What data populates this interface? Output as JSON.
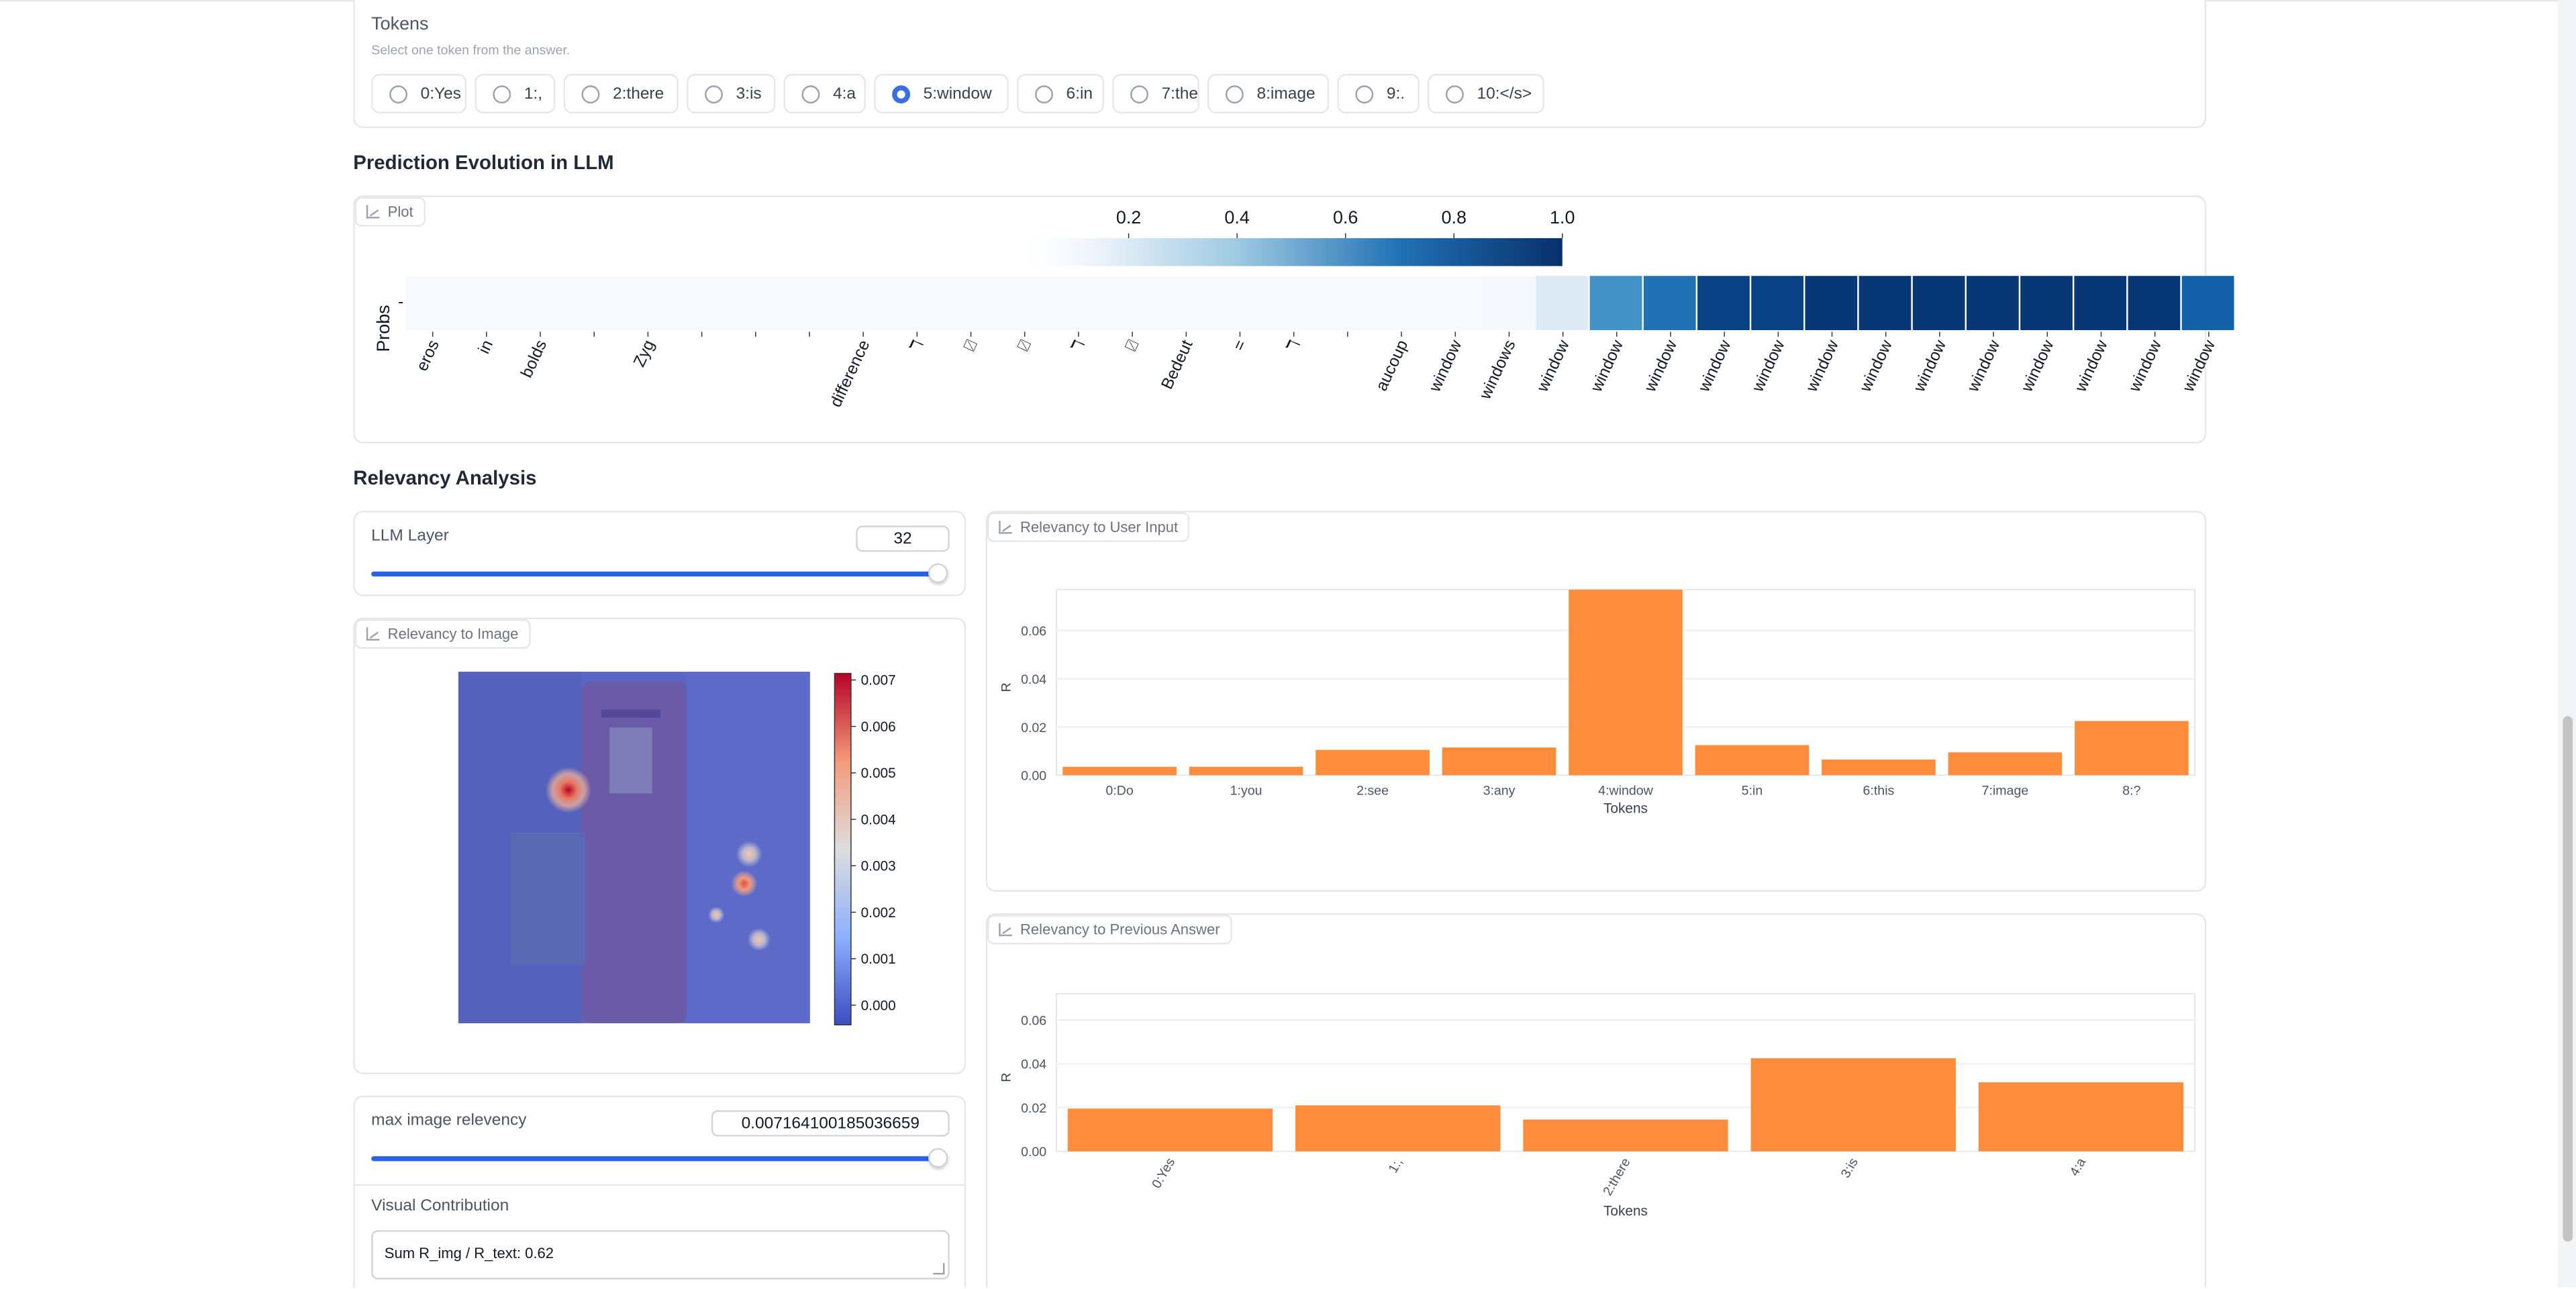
{
  "tokens_panel": {
    "title": "Tokens",
    "subtitle": "Select one token from the answer.",
    "options": [
      "0:Yes",
      "1:,",
      "2:there",
      "3:is",
      "4:a",
      "5:window",
      "6:in",
      "7:the",
      "8:image",
      "9:.",
      "10:</s>"
    ],
    "selected_index": 5
  },
  "prediction": {
    "section_title": "Prediction Evolution in LLM",
    "plot_tag": "Plot",
    "row_label": "Probs",
    "row_tick": "-",
    "colorbar_ticks": [
      "0.2",
      "0.4",
      "0.6",
      "0.8",
      "1.0"
    ],
    "colors": {
      "low": "#f7fbff",
      "high": "#08306b"
    }
  },
  "relevancy": {
    "section_title": "Relevancy Analysis",
    "llm_layer": {
      "label": "LLM Layer",
      "value": "32",
      "fraction": 1.0
    },
    "image_tag": "Relevancy to Image",
    "image_colorbar_ticks": [
      "0.007",
      "0.006",
      "0.005",
      "0.004",
      "0.003",
      "0.002",
      "0.001",
      "0.000"
    ],
    "user_input_tag": "Relevancy to User Input",
    "prev_answer_tag": "Relevancy to Previous Answer",
    "max_relevancy": {
      "label": "max image relevency",
      "value": "0.007164100185036659",
      "fraction": 1.0
    },
    "visual_contribution": {
      "label": "Visual Contribution",
      "value": "Sum R_img / R_text: 0.62"
    }
  },
  "chart_data": [
    {
      "type": "heatmap",
      "title": "",
      "ylabel": "Probs",
      "x": [
        "eros",
        "in",
        "bolds",
        "",
        "Zyg",
        "",
        "",
        "",
        "difference",
        "ℸ",
        "⍁",
        "⍁",
        "ℸ",
        "⍁",
        "Bedeut",
        "=",
        "ℸ",
        "",
        "aucoup",
        "window",
        "windows",
        "window",
        "window",
        "window",
        "window",
        "window",
        "window",
        "window",
        "window",
        "window",
        "window",
        "window",
        "window",
        "window"
      ],
      "values": [
        0.01,
        0.01,
        0.01,
        0.01,
        0.01,
        0.01,
        0.01,
        0.01,
        0.01,
        0.01,
        0.01,
        0.01,
        0.01,
        0.01,
        0.01,
        0.01,
        0.01,
        0.01,
        0.01,
        0.01,
        0.02,
        0.2,
        0.6,
        0.8,
        0.95,
        0.95,
        0.98,
        0.98,
        0.98,
        0.98,
        0.98,
        0.98,
        0.98,
        0.85
      ],
      "colorbar": {
        "ticks": [
          0.2,
          0.4,
          0.6,
          0.8,
          1.0
        ],
        "range": [
          0,
          1.0
        ]
      }
    },
    {
      "type": "bar",
      "title": "Relevancy to User Input",
      "xlabel": "Tokens",
      "ylabel": "R",
      "categories": [
        "0:Do",
        "1:you",
        "2:see",
        "3:any",
        "4:window",
        "5:in",
        "6:this",
        "7:image",
        "8:?"
      ],
      "values": [
        0.0035,
        0.0035,
        0.0105,
        0.0115,
        0.077,
        0.0125,
        0.0065,
        0.0095,
        0.0225
      ],
      "yticks": [
        0.0,
        0.02,
        0.04,
        0.06
      ],
      "ylim": [
        0,
        0.077
      ],
      "color": "#fd8d3c"
    },
    {
      "type": "bar",
      "title": "Relevancy to Previous Answer",
      "xlabel": "Tokens",
      "ylabel": "R",
      "categories": [
        "0:Yes",
        "1:,",
        "2:there",
        "3:is",
        "4:a"
      ],
      "values": [
        0.0195,
        0.021,
        0.0145,
        0.0425,
        0.0315
      ],
      "yticks": [
        0.0,
        0.02,
        0.04,
        0.06
      ],
      "ylim": [
        0,
        0.072
      ],
      "color": "#fd8d3c"
    },
    {
      "type": "heatmap",
      "title": "Relevancy to Image",
      "colorbar": {
        "ticks": [
          0.007,
          0.006,
          0.005,
          0.004,
          0.003,
          0.002,
          0.001,
          0.0
        ],
        "range": [
          0,
          0.0072
        ]
      }
    }
  ]
}
